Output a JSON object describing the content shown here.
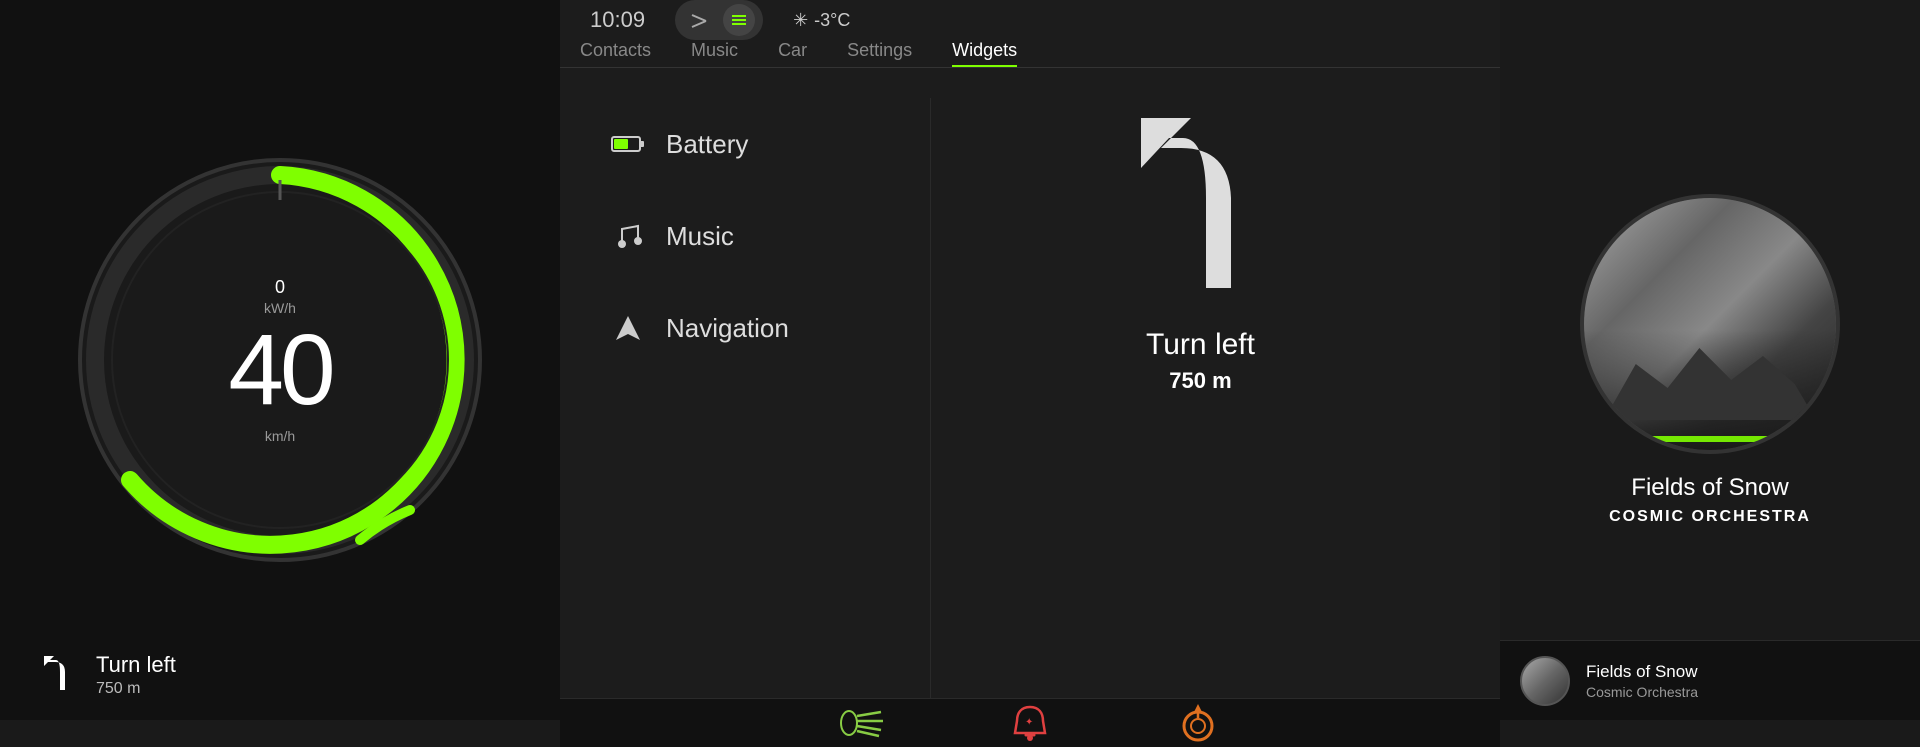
{
  "left": {
    "speed": "40",
    "speed_unit": "km/h",
    "kw_value": "0",
    "kw_unit": "kW/h",
    "turn_label": "Turn left",
    "turn_distance": "750 m"
  },
  "topbar": {
    "time": "10:09",
    "temperature": "-3°C",
    "temp_prefix": "✳"
  },
  "nav_tabs": [
    {
      "label": "Contacts",
      "active": false
    },
    {
      "label": "Music",
      "active": false
    },
    {
      "label": "Car",
      "active": false
    },
    {
      "label": "Settings",
      "active": false
    },
    {
      "label": "Widgets",
      "active": true
    }
  ],
  "widgets": [
    {
      "label": "Battery",
      "icon": "🔋"
    },
    {
      "label": "Music",
      "icon": "♩"
    },
    {
      "label": "Navigation",
      "icon": "▶"
    }
  ],
  "navigation_widget": {
    "direction": "Turn left",
    "distance": "750 m"
  },
  "bottom_icons": [
    {
      "name": "headlights",
      "symbol": "💡"
    },
    {
      "name": "warning",
      "symbol": "⚠"
    },
    {
      "name": "tire",
      "symbol": "◎"
    }
  ],
  "music": {
    "song_title": "Fields of Snow",
    "artist": "COSMIC ORCHESTRA",
    "mini_song": "Fields of Snow",
    "mini_artist": "Cosmic Orchestra"
  }
}
